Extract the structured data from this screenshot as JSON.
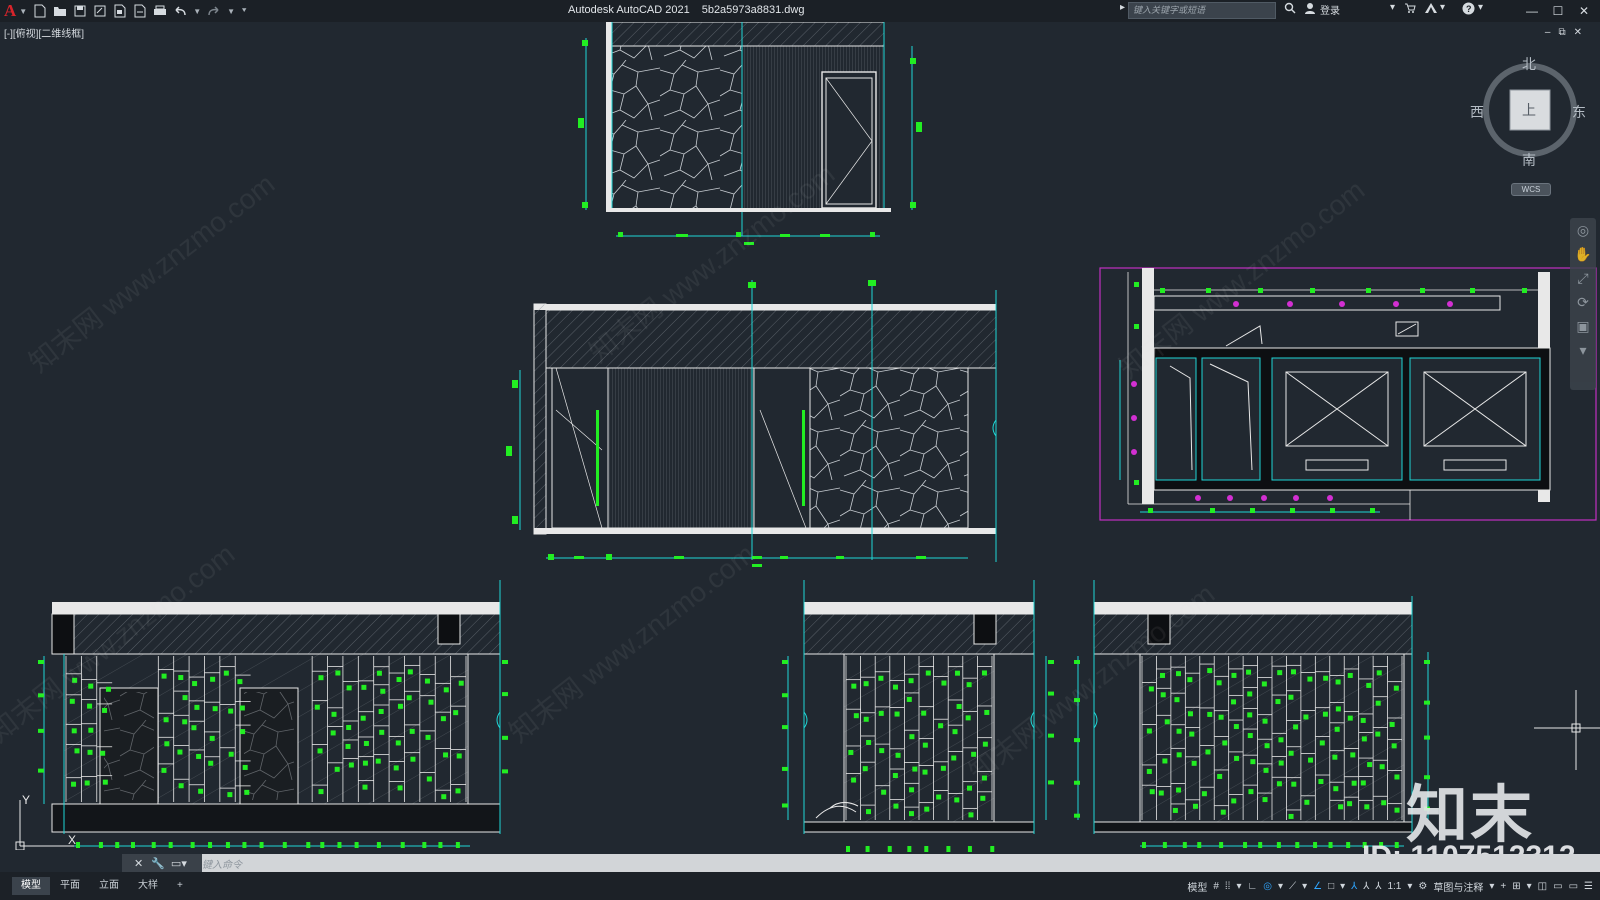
{
  "titlebar": {
    "app_title": "Autodesk AutoCAD 2021",
    "file_name": "5b2a5973a8831.dwg",
    "search_placeholder": "键入关键字或短语",
    "login_label": "登录"
  },
  "viewport": {
    "label": "[-][俯视][二维线框]"
  },
  "viewcube": {
    "north": "北",
    "south": "南",
    "east": "东",
    "west": "西",
    "face": "上",
    "wcs": "WCS"
  },
  "command": {
    "placeholder": "键入命令"
  },
  "layout_tabs": [
    {
      "label": "模型",
      "active": true
    },
    {
      "label": "平面",
      "active": false
    },
    {
      "label": "立面",
      "active": false
    },
    {
      "label": "大样",
      "active": false
    }
  ],
  "status": {
    "model_label": "模型",
    "scale_label": "1:1",
    "workspace_label": "草图与注释"
  },
  "watermark": {
    "brand": "知末",
    "id_text": "ID: 1107512312",
    "site_text": "知末网 www.znzmo.com"
  },
  "colors": {
    "background": "#212830",
    "cyan": "#1fd6d6",
    "green": "#22ee22",
    "white": "#e8e8e8",
    "magenta": "#d22fd2",
    "accent": "#2fa6ff"
  }
}
